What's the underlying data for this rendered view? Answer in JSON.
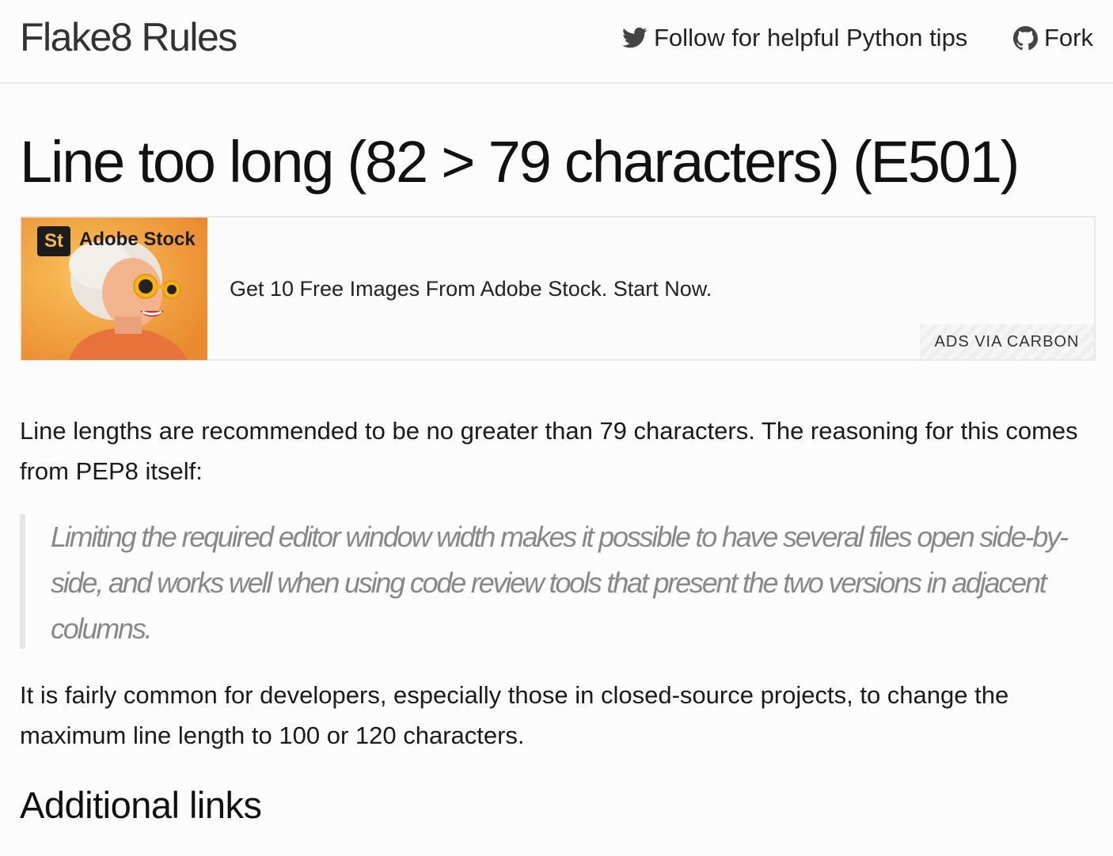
{
  "header": {
    "brand": "Flake8 Rules",
    "nav": {
      "follow_label": "Follow for helpful Python tips",
      "follow_icon": "twitter-icon",
      "fork_label": "Fork",
      "fork_icon": "github-icon"
    }
  },
  "main": {
    "title": "Line too long (82 > 79 characters) (E501)",
    "ad": {
      "brand_badge": "St",
      "brand_name": "Adobe Stock",
      "text": "Get 10 Free Images From Adobe Stock. Start Now.",
      "via": "ADS VIA CARBON"
    },
    "paragraph1": "Line lengths are recommended to be no greater than 79 characters. The reasoning for this comes from PEP8 itself:",
    "quote": "Limiting the required editor window width makes it possible to have several files open side-by-side, and works well when using code review tools that present the two versions in adjacent columns.",
    "paragraph2": "It is fairly common for developers, especially those in closed-source projects, to change the maximum line length to 100 or 120 characters.",
    "section_heading": "Additional links"
  },
  "colors": {
    "background": "#fcfcfc",
    "quote_text": "#888888",
    "quote_border": "#e6e6e6",
    "ad_image_orange": "#f29a3a"
  }
}
